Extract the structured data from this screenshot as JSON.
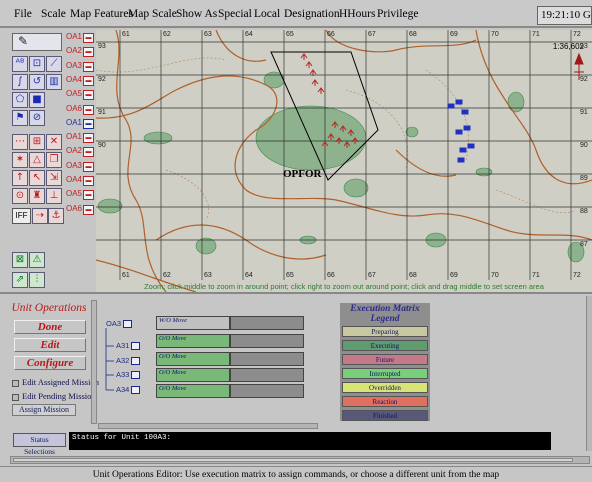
{
  "menu": {
    "items": [
      "File",
      "Scale",
      "Map Features",
      "Map Scale",
      "Show As",
      "Special",
      "Local",
      "Designation",
      "HHours",
      "Privilege"
    ],
    "clock": "19:21:10 GMT"
  },
  "palette": {
    "select_icon": "pointer-arrow",
    "iff_label": "IFF"
  },
  "units": [
    {
      "label": "OA1",
      "force": "red"
    },
    {
      "label": "OA2",
      "force": "red"
    },
    {
      "label": "OA3",
      "force": "red"
    },
    {
      "label": "OA4",
      "force": "red"
    },
    {
      "label": "OA5",
      "force": "red"
    },
    {
      "label": "OA6",
      "force": "red"
    },
    {
      "label": "OA1",
      "force": "blue"
    },
    {
      "label": "OA1",
      "force": "red"
    },
    {
      "label": "OA2",
      "force": "red"
    },
    {
      "label": "OA3",
      "force": "red"
    },
    {
      "label": "OA4",
      "force": "red"
    },
    {
      "label": "OA5",
      "force": "red"
    },
    {
      "label": "OA6",
      "force": "red"
    }
  ],
  "map": {
    "scale": "1:36,602",
    "opfor_label": "OPFOR",
    "hint": "Zoom: click middle to zoom in around point; click right to zoom out around point; click and drag middle to set screen area",
    "grid_top": [
      "61",
      "62",
      "63",
      "64",
      "65",
      "66",
      "67",
      "68",
      "69",
      "70",
      "71",
      "72"
    ],
    "grid_bottom": [
      "61",
      "62",
      "63",
      "64",
      "65",
      "66",
      "67",
      "68",
      "69",
      "70",
      "71",
      "72"
    ],
    "grid_right": [
      "93",
      "92",
      "91",
      "90",
      "89",
      "88",
      "87"
    ],
    "grid_left": [
      "93",
      "92",
      "91",
      "90"
    ],
    "colors": {
      "map_bg": "#cfcfc6",
      "grid": "#1a1a1a",
      "contour": "#b0602a",
      "vegetation": "#3c8a4a",
      "opfor": "#c02020",
      "blufor": "#2030c0"
    }
  },
  "operations": {
    "title": "Unit Operations",
    "done": "Done",
    "edit": "Edit",
    "configure": "Configure",
    "edit_assigned": "Edit Assigned Mission",
    "edit_pending": "Edit Pending Mission",
    "assign_mission": "Assign Mission"
  },
  "tree": {
    "root": "OA3",
    "children": [
      "A31",
      "A32",
      "A33",
      "A34"
    ]
  },
  "matrix": {
    "rows": [
      "W/O Move",
      "O/O Move",
      "O/O Move",
      "O/O Move",
      "O/O Move"
    ]
  },
  "legend": {
    "title_line1": "Execution Matrix",
    "title_line2": "Legend",
    "items": [
      {
        "label": "Preparing",
        "color": "#c8c8a0"
      },
      {
        "label": "Executing",
        "color": "#5f9c6f"
      },
      {
        "label": "Future",
        "color": "#c47a88"
      },
      {
        "label": "Interrupted",
        "color": "#7ad07a"
      },
      {
        "label": "Overridden",
        "color": "#d8e478"
      },
      {
        "label": "Reaction",
        "color": "#e07060"
      },
      {
        "label": "Finished",
        "color": "#58587a"
      }
    ]
  },
  "status": {
    "button": "Status Selections",
    "text": "Status for Unit 100A3:"
  },
  "footer": "Unit Operations Editor: Use execution matrix to assign commands, or choose a different unit from the map"
}
